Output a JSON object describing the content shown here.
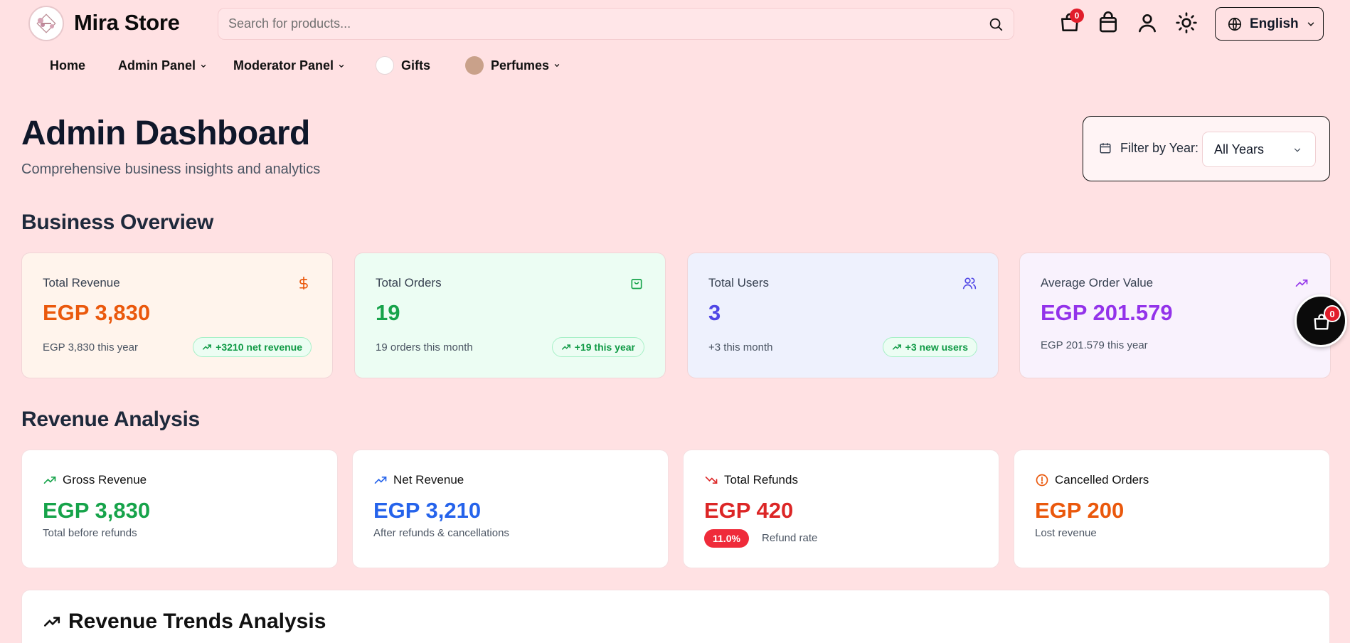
{
  "header": {
    "brand": "Mira Store",
    "search_placeholder": "Search for products...",
    "cart_count": "0",
    "language": "English"
  },
  "nav": {
    "items": [
      {
        "label": "Home"
      },
      {
        "label": "Admin Panel"
      },
      {
        "label": "Moderator Panel"
      },
      {
        "label": "Gifts"
      },
      {
        "label": "Perfumes"
      }
    ]
  },
  "page": {
    "title": "Admin Dashboard",
    "subtitle": "Comprehensive business insights and analytics"
  },
  "filter": {
    "label": "Filter by Year:",
    "selected": "All Years"
  },
  "sections": {
    "overview": "Business Overview",
    "revenue": "Revenue Analysis",
    "trends": "Revenue Trends Analysis"
  },
  "overview_cards": [
    {
      "label": "Total Revenue",
      "value": "EGP 3,830",
      "sub": "EGP 3,830 this year",
      "pill": "+3210 net revenue",
      "color": "#ea580c",
      "bg": "#fff4ec",
      "icon": "dollar-icon"
    },
    {
      "label": "Total Orders",
      "value": "19",
      "sub": "19 orders this month",
      "pill": "+19 this year",
      "color": "#16a34a",
      "bg": "#ecfdf3",
      "icon": "shopping-bag-icon"
    },
    {
      "label": "Total Users",
      "value": "3",
      "sub": "+3 this month",
      "pill": "+3 new users",
      "color": "#4f46e5",
      "bg": "#eef1fd",
      "icon": "users-icon"
    },
    {
      "label": "Average Order Value",
      "value": "EGP 201.579",
      "sub": "EGP 201.579 this year",
      "color": "#9333ea",
      "bg": "#f9f2fd",
      "icon": "trending-up-icon"
    }
  ],
  "revenue_cards": [
    {
      "label": "Gross Revenue",
      "value": "EGP 3,830",
      "sub": "Total before refunds",
      "color": "#16a34a"
    },
    {
      "label": "Net Revenue",
      "value": "EGP 3,210",
      "sub": "After refunds & cancellations",
      "color": "#2563eb"
    },
    {
      "label": "Total Refunds",
      "value": "EGP 420",
      "pill": "11.0%",
      "note": "Refund rate",
      "color": "#dc2626"
    },
    {
      "label": "Cancelled Orders",
      "value": "EGP 200",
      "sub": "Lost revenue",
      "color": "#ea580c"
    }
  ],
  "float_cart": {
    "count": "0"
  }
}
